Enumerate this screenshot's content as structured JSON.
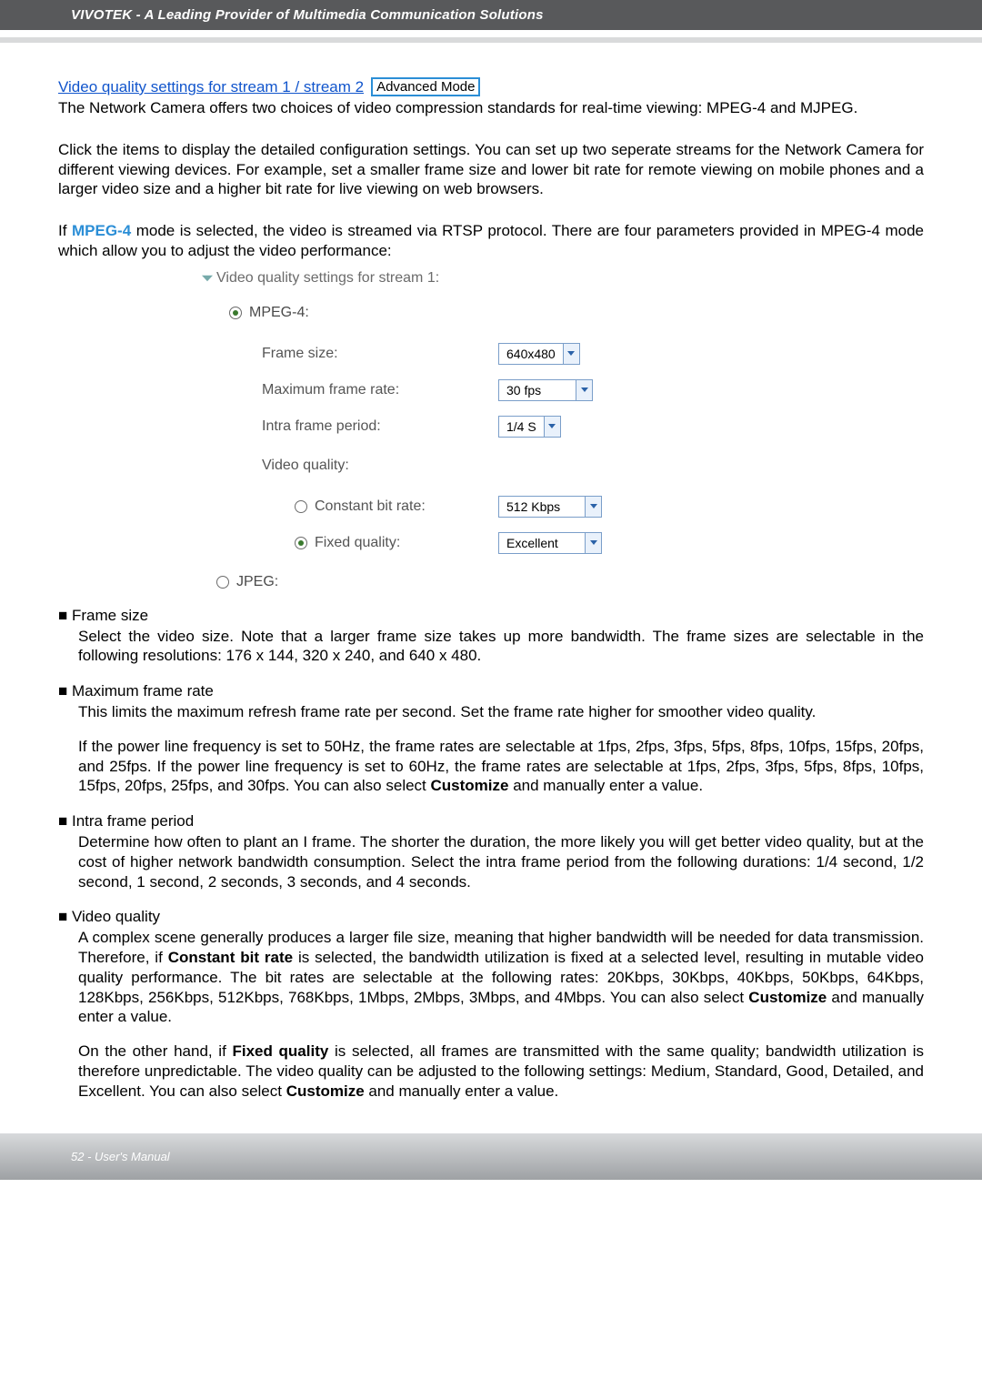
{
  "banner": "VIVOTEK - A Leading Provider of Multimedia Communication Solutions",
  "heading": {
    "link": "Video quality settings for stream 1 / stream 2",
    "badge": "Advanced Mode"
  },
  "intro1": "The Network Camera offers two choices of video compression standards for real-time viewing: MPEG-4 and MJPEG.",
  "intro2": "Click the items to display the detailed configuration settings. You can set up two seperate streams for the Network Camera for different viewing devices. For example, set a smaller frame size and lower bit rate for remote viewing on mobile phones and a larger video size and a higher bit rate for live viewing on web browsers.",
  "mpeg": {
    "prefix": "If ",
    "keyword": "MPEG-4",
    "suffix": " mode is selected, the video is streamed via RTSP protocol. There are four parameters provided in MPEG-4 mode which allow you to adjust the video performance:"
  },
  "panel": {
    "title": "Video quality settings for stream 1:",
    "mpeg4": "MPEG-4:",
    "jpeg": "JPEG:",
    "rows": {
      "frame_size": {
        "label": "Frame size:",
        "value": "640x480"
      },
      "max_frame_rate": {
        "label": "Maximum frame rate:",
        "value": "30 fps"
      },
      "intra_period": {
        "label": "Intra frame period:",
        "value": "1/4 S"
      },
      "video_quality": {
        "label": "Video quality:"
      },
      "constant_bitrate": {
        "label": "Constant bit rate:",
        "value": "512 Kbps"
      },
      "fixed_quality": {
        "label": "Fixed quality:",
        "value": "Excellent"
      }
    }
  },
  "bullets": {
    "frame_size": {
      "head": "Frame size",
      "body": "Select the video size. Note that a larger frame size takes up more bandwidth. The frame sizes are selectable in the following resolutions: 176 x 144, 320 x 240, and 640 x 480."
    },
    "max_frame_rate": {
      "head": "Maximum frame rate",
      "body1": "This limits the maximum refresh frame rate per second. Set the frame rate higher for smoother video quality.",
      "body2_a": "If the power line frequency is set to 50Hz, the frame rates are selectable at 1fps, 2fps, 3fps, 5fps, 8fps, 10fps, 15fps, 20fps, and 25fps. If the power line frequency is set to 60Hz, the frame rates are selectable at 1fps, 2fps, 3fps, 5fps, 8fps, 10fps, 15fps, 20fps, 25fps, and 30fps. You can also select ",
      "body2_bold": "Customize",
      "body2_b": " and manually enter a value."
    },
    "intra_frame": {
      "head": "Intra frame period",
      "body": "Determine how often to plant an I frame. The shorter the duration, the more likely you will get better video quality, but at the cost of higher network bandwidth consumption. Select the intra frame period from the following durations: 1/4 second, 1/2 second, 1 second, 2 seconds, 3 seconds, and 4 seconds."
    },
    "video_quality": {
      "head": "Video quality",
      "p1_a": "A complex scene generally produces a larger file size, meaning that higher bandwidth will be needed for data transmission. Therefore, if ",
      "p1_bold1": "Constant bit rate",
      "p1_b": " is selected, the bandwidth utilization is fixed at a selected level, resulting in mutable video quality performance. The bit rates are selectable at the following rates: 20Kbps, 30Kbps, 40Kbps, 50Kbps, 64Kbps, 128Kbps, 256Kbps, 512Kbps, 768Kbps, 1Mbps, 2Mbps, 3Mbps, and 4Mbps. You can also select ",
      "p1_bold2": "Customize",
      "p1_c": " and manually enter a value.",
      "p2_a": "On the other hand, if ",
      "p2_bold1": "Fixed quality",
      "p2_b": " is selected, all frames are transmitted with the same quality; bandwidth utilization is therefore unpredictable. The video quality can be adjusted to the following settings: Medium, Standard, Good, Detailed, and Excellent. You can also select ",
      "p2_bold2": "Customize",
      "p2_c": " and manually enter a value."
    }
  },
  "footer": "52 - User's Manual"
}
